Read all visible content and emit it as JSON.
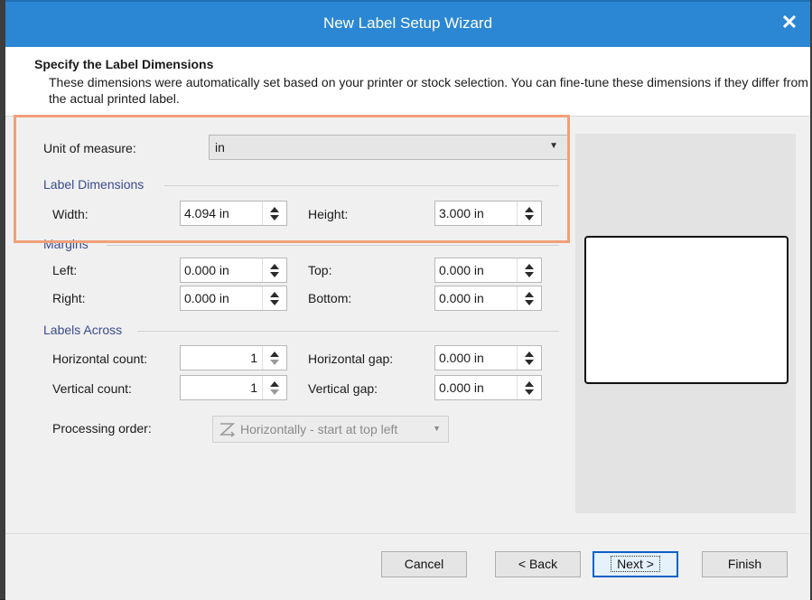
{
  "window": {
    "title": "New Label Setup Wizard",
    "close_symbol": "✕"
  },
  "header": {
    "title": "Specify the Label Dimensions",
    "description": "These dimensions were automatically set based on your printer or stock selection. You can fine-tune these dimensions if they differ from the actual printed label."
  },
  "unit": {
    "label": "Unit of measure:",
    "value": "in"
  },
  "label_dimensions": {
    "section": "Label Dimensions",
    "width_label": "Width:",
    "width_value": "4.094 in",
    "height_label": "Height:",
    "height_value": "3.000 in"
  },
  "margins": {
    "section": "Margins",
    "left_label": "Left:",
    "left_value": "0.000 in",
    "top_label": "Top:",
    "top_value": "0.000 in",
    "right_label": "Right:",
    "right_value": "0.000 in",
    "bottom_label": "Bottom:",
    "bottom_value": "0.000 in"
  },
  "labels_across": {
    "section": "Labels Across",
    "hcount_label": "Horizontal count:",
    "hcount_value": "1",
    "hgap_label": "Horizontal gap:",
    "hgap_value": "0.000 in",
    "vcount_label": "Vertical count:",
    "vcount_value": "1",
    "vgap_label": "Vertical gap:",
    "vgap_value": "0.000 in"
  },
  "processing": {
    "label": "Processing order:",
    "value": "Horizontally - start at top left"
  },
  "footer": {
    "cancel": "Cancel",
    "back": "< Back",
    "next": "Next >",
    "finish": "Finish"
  },
  "colors": {
    "titlebar": "#2b87d3",
    "highlight": "#f0a07a",
    "section": "#3a4a8f"
  },
  "icons": [
    "close-icon",
    "dropdown-arrow-icon",
    "spin-up-icon",
    "spin-down-icon",
    "processing-order-icon"
  ]
}
